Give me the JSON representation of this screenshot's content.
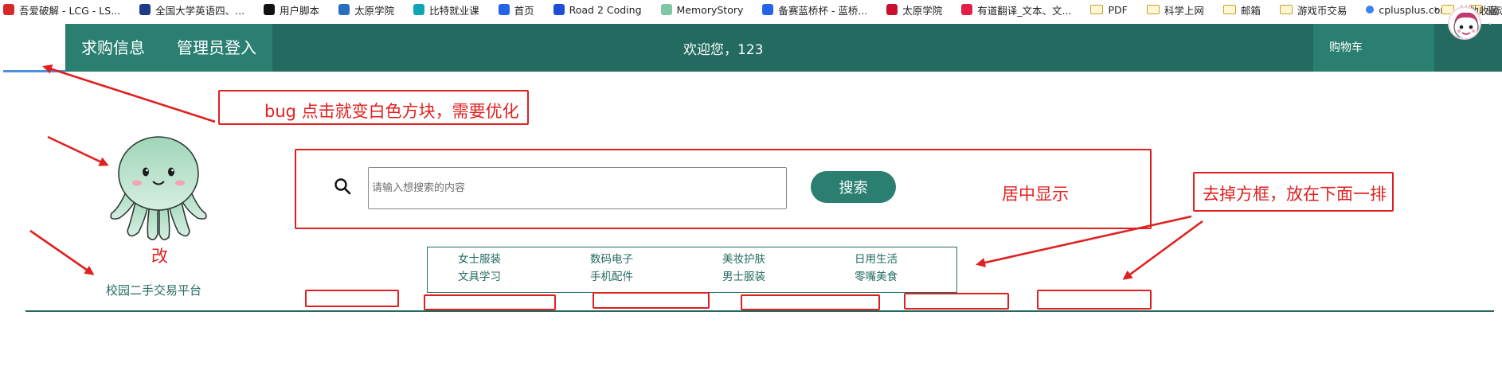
{
  "bookmarks": {
    "items": [
      {
        "label": "吾爱破解 - LCG - LS...",
        "color": "#d62828"
      },
      {
        "label": "全国大学英语四、...",
        "color": "#1e3a8a"
      },
      {
        "label": "用户脚本",
        "color": "#111111"
      },
      {
        "label": "太原学院",
        "color": "#2a6fbf"
      },
      {
        "label": "比特就业课",
        "color": "#0ea5b7"
      },
      {
        "label": "首页",
        "color": "#2563eb"
      },
      {
        "label": "Road 2 Coding",
        "color": "#1d4ed8"
      },
      {
        "label": "MemoryStory",
        "color": "#7fc6a4"
      },
      {
        "label": "备赛蓝桥杯 - 蓝桥...",
        "color": "#2563eb"
      },
      {
        "label": "太原学院",
        "color": "#c8102e"
      },
      {
        "label": "有道翻译_文本、文...",
        "color": "#e11d48"
      }
    ],
    "folders": [
      "PDF",
      "科学上网",
      "邮箱",
      "游戏币交易"
    ],
    "cplusplus": "cplusplus.com",
    "folder_drive": "驱动",
    "more_chevron": "›",
    "other_bookmarks": "其他收藏"
  },
  "nav": {
    "menu": [
      "求购信息",
      "管理员登入"
    ],
    "welcome": "欢迎您，123",
    "cart": "购物车",
    "avatar_icon": "user-avatar-icon",
    "chevron": "⌄"
  },
  "brand": {
    "logo_icon": "octopus-mascot-icon",
    "name": "校园二手交易平台"
  },
  "search": {
    "placeholder": "请输入想搜索的内容",
    "value": "",
    "button": "搜索"
  },
  "categories": [
    "女士服装",
    "数码电子",
    "美妆护肤",
    "日用生活",
    "文具学习",
    "手机配件",
    "男士服装",
    "零嘴美食"
  ],
  "annotations": {
    "bug": "bug 点击就变白色方块，需要优化",
    "change_logo": "改",
    "center": "居中显示",
    "remove_frame": "去掉方框，放在下面一排"
  },
  "colors": {
    "brand_green": "#236b60",
    "menu_green": "#2a7f70",
    "annotation_red": "#e02020"
  }
}
